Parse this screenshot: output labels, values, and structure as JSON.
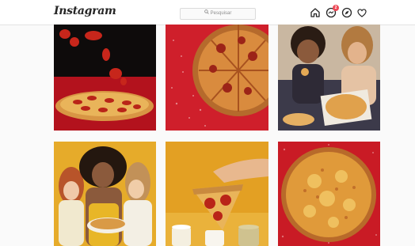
{
  "app": {
    "logo_text": "Instagram"
  },
  "search": {
    "placeholder": "Pesquisar",
    "icon": "search-icon"
  },
  "nav": {
    "icons": [
      "home-icon",
      "direct-message-icon",
      "explore-icon",
      "activity-heart-icon"
    ],
    "direct_badge": "2"
  },
  "colors": {
    "background": "#fafafa",
    "topbar": "#ffffff",
    "badge": "#ed4956",
    "pizza_red": "#c8102e",
    "mustard": "#e3a526"
  },
  "feed": {
    "posts": [
      {
        "subject": "pepperoni-pizza-floating-slices"
      },
      {
        "subject": "pizza-closeup-red-background"
      },
      {
        "subject": "women-eating-pizza-from-box"
      },
      {
        "subject": "three-women-sharing-pizza"
      },
      {
        "subject": "hand-holding-pizza-slice"
      },
      {
        "subject": "cheese-pizza-top-view"
      }
    ]
  }
}
